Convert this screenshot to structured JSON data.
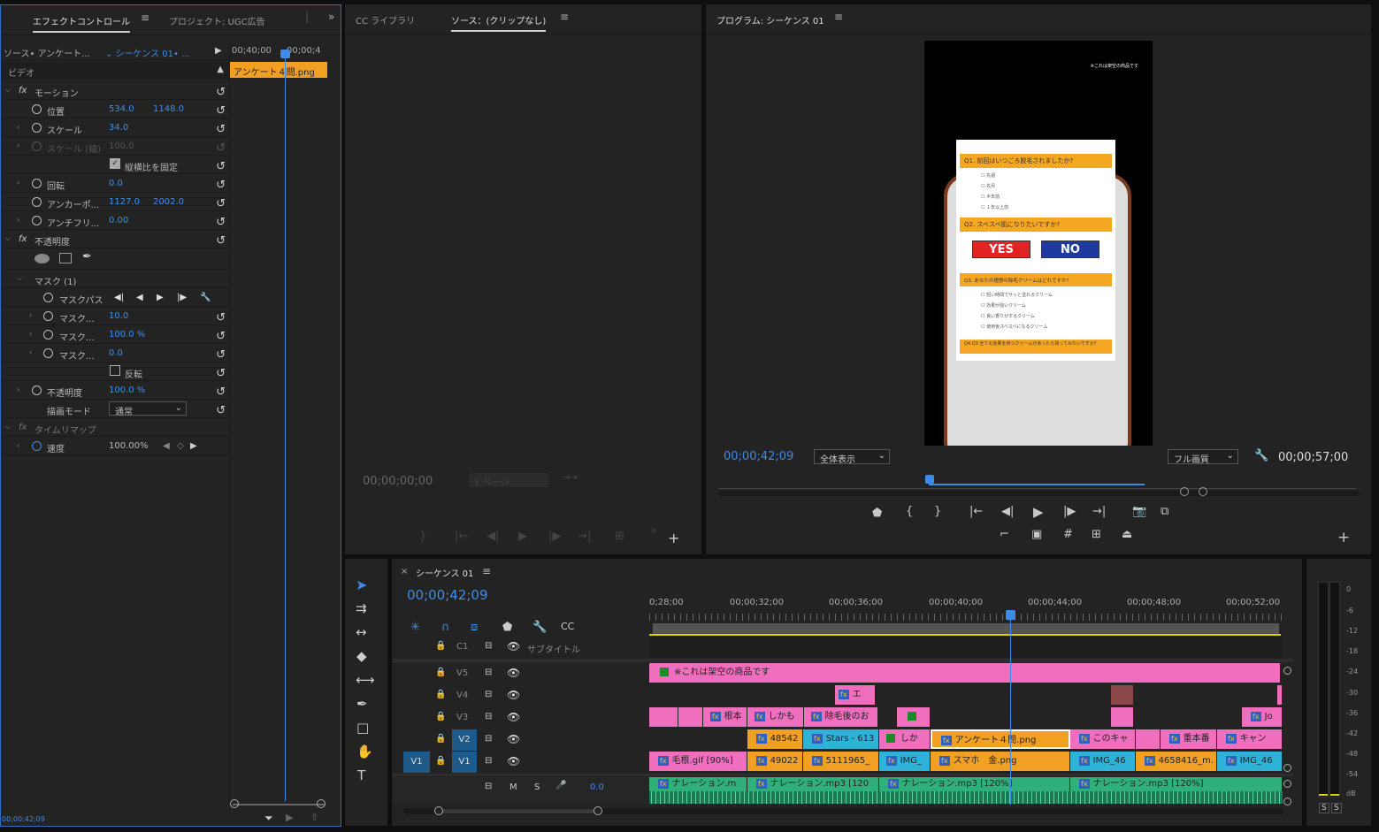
{
  "effect_panel": {
    "tab_effect": "エフェクトコントロール",
    "tab_project": "プロジェクト: UGC広告",
    "source_label": "ソース• アンケート...",
    "sequence_label": "シーケンス 01• ...",
    "ruler_t1": "00;40;00",
    "ruler_t2": "00;00;4",
    "clip_name": "アンケート４問.png",
    "video_label": "ビデオ",
    "motion": "モーション",
    "position_label": "位置",
    "position_x": "534.0",
    "position_y": "1148.0",
    "scale_label": "スケール",
    "scale_val": "34.0",
    "scale_w_label": "スケール (幅)",
    "scale_w_val": "100.0",
    "uniform_label": "縦横比を固定",
    "rotation_label": "回転",
    "rotation_val": "0.0",
    "anchor_label": "アンカーポ...",
    "anchor_x": "1127.0",
    "anchor_y": "2002.0",
    "antiflicker_label": "アンチフリ...",
    "antiflicker_val": "0.00",
    "opacity_section": "不透明度",
    "mask_label": "マスク (1)",
    "mask_path": "マスクパス",
    "mask_feather_label": "マスク...",
    "mask_feather": "10.0",
    "mask_opacity_label": "マスク...",
    "mask_opacity": "100.0 %",
    "mask_expand_label": "マスク...",
    "mask_expand": "0.0",
    "invert_label": "反転",
    "opacity_label": "不透明度",
    "opacity_val": "100.0 %",
    "blend_label": "描画モード",
    "blend_val": "通常",
    "timeremap": "タイムリマップ",
    "speed_label": "速度",
    "speed_val": "100.00%",
    "footer_time": "00;00;42;09"
  },
  "source_panel": {
    "tab_cc": "CC ライブラリ",
    "tab_source": "ソース：(クリップなし)",
    "timecode": "00;00;00;00",
    "page": "1 ページ"
  },
  "program_panel": {
    "title": "プログラム: シーケンス 01",
    "timecode": "00;00;42;09",
    "zoom": "全体表示",
    "quality": "フル画質",
    "duration": "00;00;57;00"
  },
  "video_frame": {
    "disclaimer": "※これは架空の商品です",
    "q1": "Q1. 前回はいつごろ脱毛されましたか?",
    "q1_opts": [
      "先週",
      "先月",
      "半年前",
      "１年以上前"
    ],
    "q2": "Q2. スベスベ肌になりたいですか?",
    "yes": "YES",
    "no": "NO",
    "q3": "Q3. あなたの理想の除毛クリームはどれですか?",
    "q3_opts": [
      "短い時間でサッと塗れるクリーム",
      "効果が強いクリーム",
      "良い香りがするクリーム",
      "使用後スベスベになるクリーム"
    ],
    "q4": "Q4.Q3.全ての効果を持つクリームがあったら買ってみたいですか?"
  },
  "timeline": {
    "tab": "シーケンス 01",
    "timecode": "00;00;42;09",
    "ruler": [
      "0;28;00",
      "00;00;32;00",
      "00;00;36;00",
      "00;00;40;00",
      "00;00;44;00",
      "00;00;48;00",
      "00;00;52;00"
    ],
    "subtitle": "サブタイトル",
    "tracks": [
      "C1",
      "V5",
      "V4",
      "V3",
      "V2",
      "V1"
    ],
    "v1_source": "V1",
    "a_m": "M",
    "a_s": "S",
    "a_val": "0.0",
    "clips_v5": [
      "※これは架空の商品です"
    ],
    "clips_v4": [
      "エ"
    ],
    "clips_v3": [
      "根本",
      "しかも",
      "除毛後のお",
      "Jo"
    ],
    "clips_v2": [
      "48542",
      "Stars - 613",
      "しか",
      "アンケート４問.png",
      "このキャ",
      "重本番",
      "キャン"
    ],
    "clips_v1": [
      "毛根.gif [90%]",
      "49022",
      "5111965_",
      "IMG_",
      "スマホ　金.png",
      "IMG_46",
      "4658416_m.",
      "IMG_46"
    ],
    "clips_a1": [
      "ナレーション.m",
      "ナレーション.mp3 [120",
      "ナレーション.mp3 [120%]",
      "ナレーション.mp3 [120%]"
    ]
  },
  "meter": {
    "labels": [
      "0",
      "-6",
      "-12",
      "-18",
      "-24",
      "-30",
      "-36",
      "-42",
      "-48",
      "-54",
      "dB"
    ],
    "s1": "S",
    "s2": "S"
  }
}
